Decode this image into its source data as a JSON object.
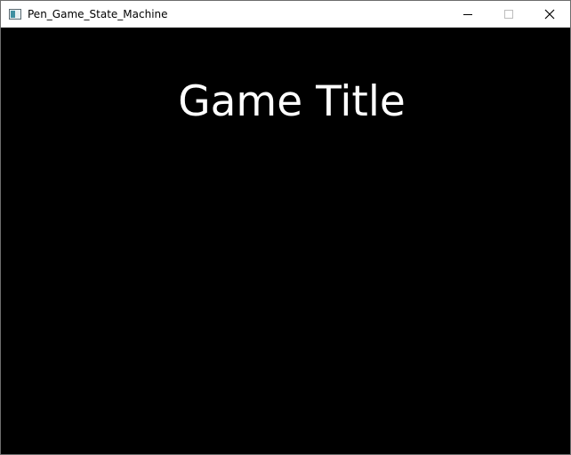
{
  "window": {
    "title": "Pen_Game_State_Machine",
    "icon": "app-window-icon",
    "controls": {
      "minimize_icon": "minimize-icon",
      "maximize_icon": "maximize-icon",
      "close_icon": "close-icon"
    }
  },
  "game": {
    "title": "Game Title",
    "background_color": "#000000",
    "title_color": "#ffffff"
  }
}
